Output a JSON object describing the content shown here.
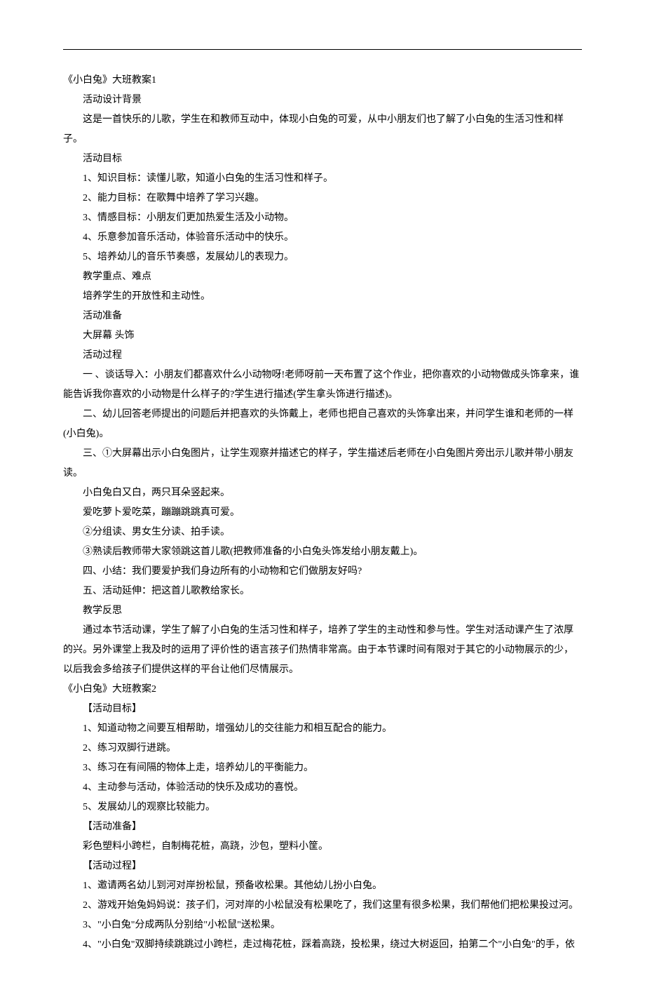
{
  "sections": [
    {
      "title": "《小白兔》大班教案1",
      "lines": [
        "活动设计背景",
        "这是一首快乐的儿歌，学生在和教师互动中，体现小白兔的可爱，从中小朋友们也了解了小白兔的生活习性和样子。",
        "活动目标",
        "1、知识目标：读懂儿歌，知道小白兔的生活习性和样子。",
        "2、能力目标：在歌舞中培养了学习兴趣。",
        "3、情感目标：小朋友们更加热爱生活及小动物。",
        "4、乐意参加音乐活动，体验音乐活动中的快乐。",
        "5、培养幼儿的音乐节奏感，发展幼儿的表现力。",
        "教学重点、难点",
        "培养学生的开放性和主动性。",
        "活动准备",
        "大屏幕 头饰",
        "活动过程",
        "一 、谈话导入：小朋友们都喜欢什么小动物呀!老师呀前一天布置了这个作业，把你喜欢的小动物做成头饰拿来，谁能告诉我你喜欢的小动物是什么样子的?学生进行描述(学生拿头饰进行描述)。",
        "二、幼儿回答老师提出的问题后并把喜欢的头饰戴上，老师也把自己喜欢的头饰拿出来，并问学生谁和老师的一样(小白兔)。",
        "三、①大屏幕出示小白兔图片，让学生观察并描述它的样子，学生描述后老师在小白兔图片旁出示儿歌并带小朋友读。",
        "小白兔白又白，两只耳朵竖起来。",
        "爱吃萝卜爱吃菜，蹦蹦跳跳真可爱。",
        "②分组读、男女生分读、拍手读。",
        "③熟读后教师带大家领跳这首儿歌(把教师准备的小白兔头饰发给小朋友戴上)。",
        "四、小结：我们要爱护我们身边所有的小动物和它们做朋友好吗?",
        "五、活动延伸：把这首儿歌教给家长。",
        "教学反思",
        "通过本节活动课，学生了解了小白兔的生活习性和样子，培养了学生的主动性和参与性。学生对活动课产生了浓厚的兴。另外课堂上我及时的运用了评价性的语言孩子们热情非常高。由于本节课时间有限对于其它的小动物展示的少，以后我会多给孩子们提供这样的平台让他们尽情展示。"
      ]
    },
    {
      "title": "《小白兔》大班教案2",
      "lines": [
        "【活动目标】",
        "1、知道动物之间要互相帮助，增强幼儿的交往能力和相互配合的能力。",
        "2、练习双脚行进跳。",
        "3、练习在有间隔的物体上走，培养幼儿的平衡能力。",
        "4、主动参与活动，体验活动的快乐及成功的喜悦。",
        "5、发展幼儿的观察比较能力。",
        "【活动准备】",
        "彩色塑料小跨栏，自制梅花桩，高跷，沙包，塑料小筐。",
        "【活动过程】",
        "1、邀请两名幼儿到河对岸扮松鼠，预备收松果。其他幼儿扮小白兔。",
        "2、游戏开始兔妈妈说：孩子们，河对岸的小松鼠没有松果吃了，我们这里有很多松果，我们帮他们把松果投过河。",
        "3、\"小白兔\"分成两队分别给\"小松鼠\"送松果。",
        "4、\"小白兔\"双脚持续跳跳过小跨栏，走过梅花桩，踩着高跷，投松果，绕过大树返回，拍第二个\"小白兔\"的手，依"
      ]
    }
  ]
}
